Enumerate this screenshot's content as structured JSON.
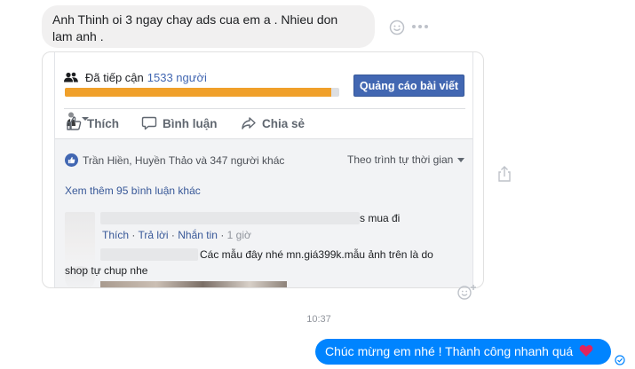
{
  "incoming_message": {
    "line1": "Anh Thinh oi 3 ngay chay ads cua em a . Nhieu don",
    "line2": "lam anh ."
  },
  "shared_post": {
    "reach_label": "Đã tiếp cận",
    "reach_count": "1533 người",
    "reach_progress": 0.97,
    "boost_button": "Quảng cáo bài viết",
    "actions": {
      "like": "Thích",
      "comment": "Bình luận",
      "share": "Chia sẻ"
    },
    "reactions_text": "Trần Hiền, Huyền Thảo và 347 người khác",
    "order_label": "Theo trình tự thời gian",
    "view_more": "Xem thêm 95 bình luận khác",
    "comments": [
      {
        "text": "s mua đi",
        "like": "Thích",
        "reply": "Trả lời",
        "message": "Nhắn tin",
        "time": "1 giờ"
      },
      {
        "text_line1": "Các mẫu đây nhé mn.giá399k.mẫu ảnh trên là do",
        "text_line2": "shop tự chup nhe"
      }
    ]
  },
  "timestamp": "10:37",
  "outgoing_message": {
    "text": "Chúc mừng em nhé ! Thành công nhanh quá"
  },
  "colors": {
    "messenger_blue": "#0084ff",
    "facebook_blue": "#4267b2",
    "reach_orange": "#f0a02a"
  },
  "icons": [
    "smile-icon",
    "more-icon",
    "people-icon",
    "like-icon",
    "comment-icon",
    "share-icon",
    "profile-icon",
    "share-upload-icon",
    "add-reaction-icon",
    "heart-icon",
    "seen-icon"
  ]
}
